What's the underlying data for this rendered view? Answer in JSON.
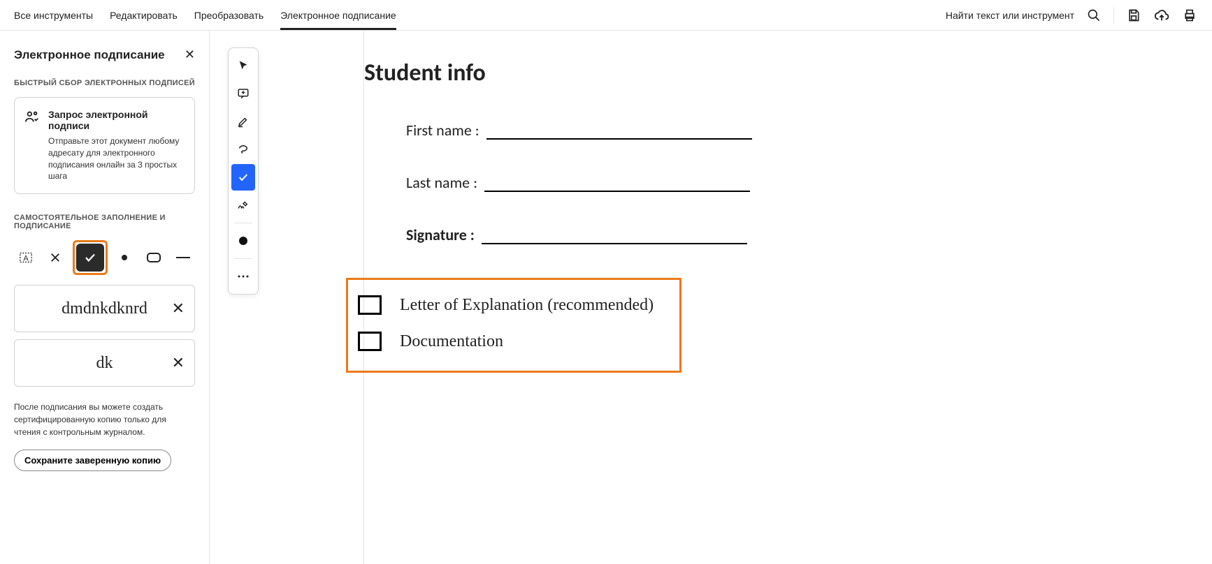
{
  "topbar": {
    "tabs": [
      "Все инструменты",
      "Редактировать",
      "Преобразовать",
      "Электронное подписание"
    ],
    "active_tab_index": 3,
    "search_hint": "Найти текст или инструмент"
  },
  "sidebar": {
    "title": "Электронное подписание",
    "section1_label": "БЫСТРЫЙ СБОР ЭЛЕКТРОННЫХ ПОДПИСЕЙ",
    "request_card": {
      "title": "Запрос электронной подписи",
      "desc": "Отправьте этот документ любому адресату для электронного подписания онлайн за 3 простых шага"
    },
    "section2_label": "САМОСТОЯТЕЛЬНОЕ ЗАПОЛНЕНИЕ И ПОДПИСАНИЕ",
    "signatures": [
      "dmdnkdknrd",
      "dk"
    ],
    "note": "После подписания вы можете создать сертифицированную копию только для чтения с контрольным журналом.",
    "save_btn": "Сохраните заверенную копию"
  },
  "document": {
    "title": "Student info",
    "fields": {
      "first_name": "First name :",
      "last_name": "Last name :",
      "signature": "Signature :"
    },
    "checkboxes": [
      "Letter of Explanation (recommended)",
      "Documentation"
    ]
  }
}
